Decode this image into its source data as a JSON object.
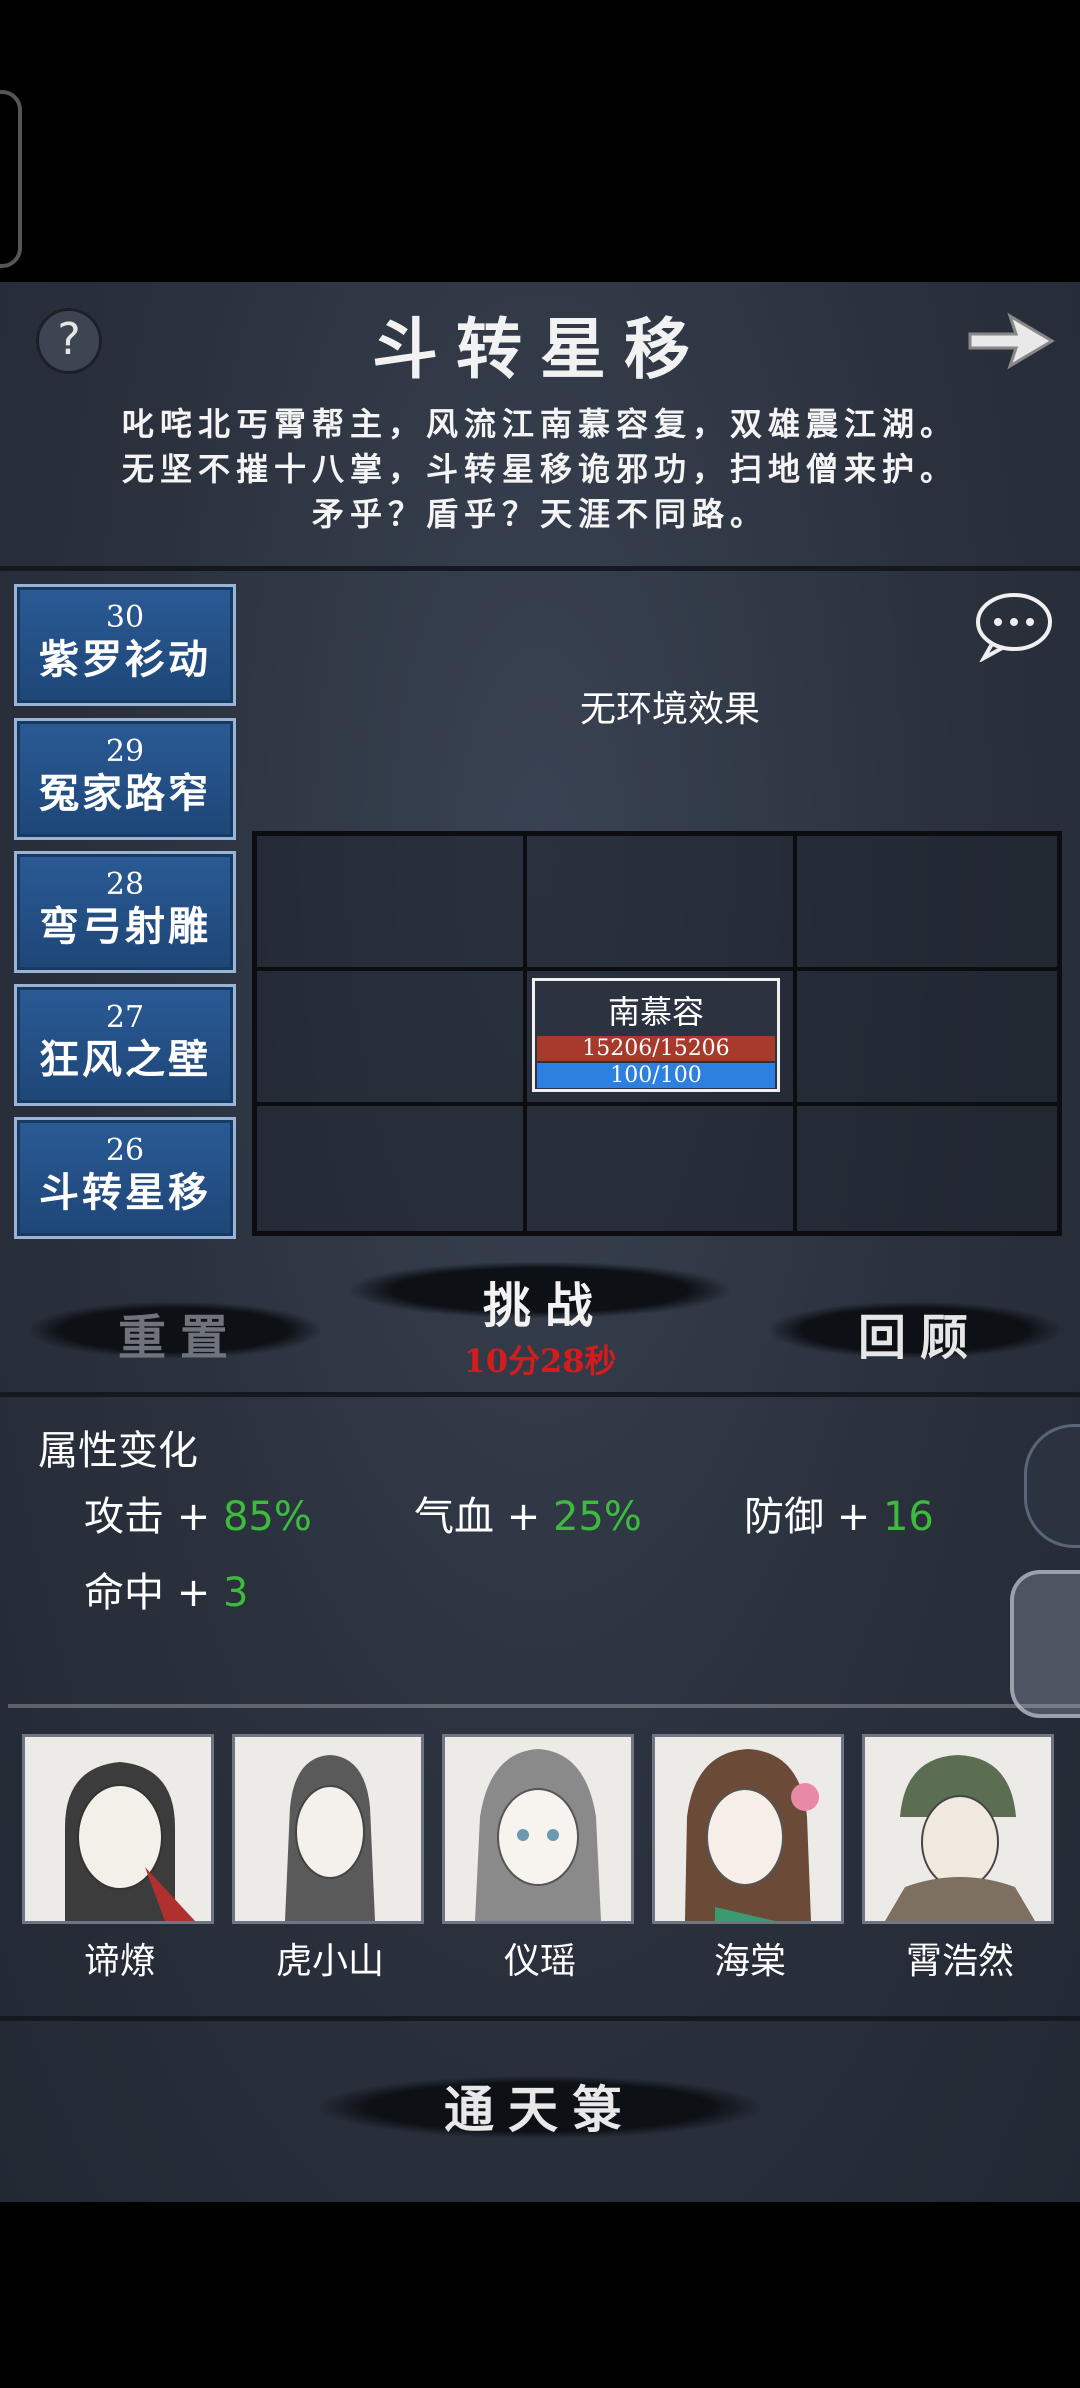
{
  "header": {
    "title": "斗转星移",
    "description_lines": [
      "叱咤北丐霄帮主，风流江南慕容复，双雄震江湖。",
      "无坚不摧十八掌，斗转星移诡邪功，扫地僧来护。",
      "矛乎？盾乎？天涯不同路。"
    ]
  },
  "levels": [
    {
      "num": "30",
      "name": "紫罗衫动"
    },
    {
      "num": "29",
      "name": "冤家路窄"
    },
    {
      "num": "28",
      "name": "弯弓射雕"
    },
    {
      "num": "27",
      "name": "狂风之壁"
    },
    {
      "num": "26",
      "name": "斗转星移"
    }
  ],
  "environment": "无环境效果",
  "enemy": {
    "name": "南慕容",
    "hp": "15206/15206",
    "mp": "100/100",
    "hp_fraction": 1.0,
    "mp_fraction": 1.0
  },
  "actions": {
    "reset": "重置",
    "challenge": "挑战",
    "timer": "10分28秒",
    "review": "回顾"
  },
  "attributes": {
    "title": "属性变化",
    "items": [
      {
        "label": "攻击 + ",
        "value": "85%"
      },
      {
        "label": "气血 + ",
        "value": "25%"
      },
      {
        "label": "防御 + ",
        "value": "16"
      },
      {
        "label": "命中 + ",
        "value": "3"
      }
    ]
  },
  "heroes": [
    {
      "name": "谛燎"
    },
    {
      "name": "虎小山"
    },
    {
      "name": "仪瑶"
    },
    {
      "name": "海棠"
    },
    {
      "name": "霄浩然"
    }
  ],
  "footer": {
    "label": "通天箓"
  },
  "colors": {
    "accent_green": "#3cbb3c",
    "timer_red": "#d21d1d",
    "level_blue": "#2a5a95",
    "hp_red": "#a83a2c",
    "mp_blue": "#2d7fe0"
  }
}
